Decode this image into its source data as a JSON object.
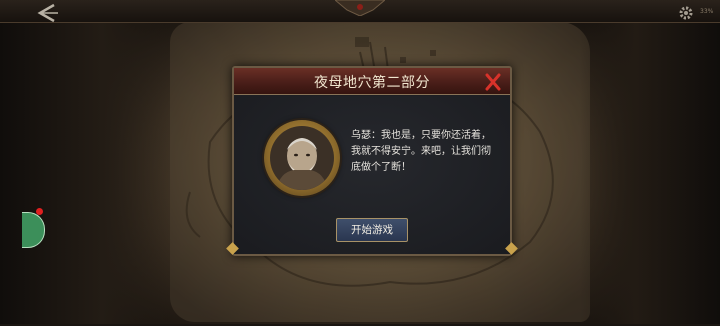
{
  "dialog": {
    "title": "夜母地穴第二部分",
    "text": "乌瑟：我也是，只要你还活着，我就不得安宁。来吧，让我们彻底做个了断！",
    "start_button": "开始游戏"
  },
  "status": {
    "battery": "33%"
  },
  "icons": {
    "back": "back-arrow-icon",
    "settings": "gear-icon",
    "close": "close-x-icon"
  },
  "colors": {
    "header_red": "#5a231c",
    "close_x": "#d8322a",
    "button_blue": "#34415c",
    "frame_gold": "#c9a24c"
  }
}
